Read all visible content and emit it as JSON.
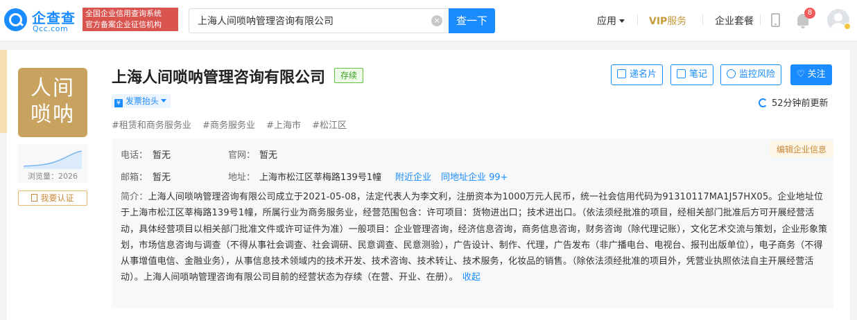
{
  "header": {
    "logo": {
      "name": "企查查",
      "domain": "Qcc.com"
    },
    "slogan": [
      "全国企业信用查询系统",
      "官方备案企业征信机构"
    ],
    "search": {
      "value": "上海人间唢呐管理咨询有限公司",
      "clear_icon": "×",
      "button": "查一下"
    },
    "nav": {
      "apps": "应用",
      "vip": "VIP",
      "vip_service": "服务",
      "package": "企业套餐"
    },
    "notifications": "8"
  },
  "company": {
    "logo_text": [
      "人间",
      "唢呐"
    ],
    "visits": "浏览量：2026",
    "verify": "我要认证",
    "name": "上海人间唢呐管理咨询有限公司",
    "status": "存续",
    "invoice": {
      "icon": "¥",
      "label": "发票抬头"
    },
    "tags": [
      "#租赁和商务服务业",
      "#商务服务业",
      "#上海市",
      "#松江区"
    ],
    "actions": {
      "card": "递名片",
      "note": "笔记",
      "monitor": "监控风险",
      "follow": "关注",
      "heart": "♡"
    },
    "updated": "52分钟前更新"
  },
  "info": {
    "phone_label": "电话：",
    "phone": "暂无",
    "website_label": "官网：",
    "website": "暂无",
    "email_label": "邮箱：",
    "email": "暂无",
    "address_label": "地址：",
    "address": "上海市松江区莘梅路139号1幢",
    "nearby": "附近企业",
    "same_address": "同地址企业 99+",
    "edit": "编辑企业信息",
    "intro_label": "简介：",
    "intro": "上海人间唢呐管理咨询有限公司成立于2021-05-08，法定代表人为李文利，注册资本为1000万元人民币，统一社会信用代码为91310117MA1J57HX05。企业地址位于上海市松江区莘梅路139号1幢，所属行业为商务服务业，经营范围包含：许可项目：货物进出口；技术进出口。（依法须经批准的项目，经相关部门批准后方可开展经营活动，具体经营项目以相关部门批准文件或许可证件为准）一般项目：企业管理咨询，经济信息咨询，商务信息咨询，财务咨询（除代理记账），文化艺术交流与策划，企业形象策划，市场信息咨询与调查（不得从事社会调查、社会调研、民意调查、民意测验），广告设计、制作、代理，广告发布（非广播电台、电视台、报刊出版单位），电子商务（不得从事增值电信、金融业务），从事信息技术领域内的技术开发、技术咨询、技术转让、技术服务，化妆品的销售。（除依法须经批准的项目外，凭营业执照依法自主开展经营活动）。上海人间唢呐管理咨询有限公司目前的经营状态为存续（在营、开业、在册）。",
    "collapse": "收起"
  }
}
